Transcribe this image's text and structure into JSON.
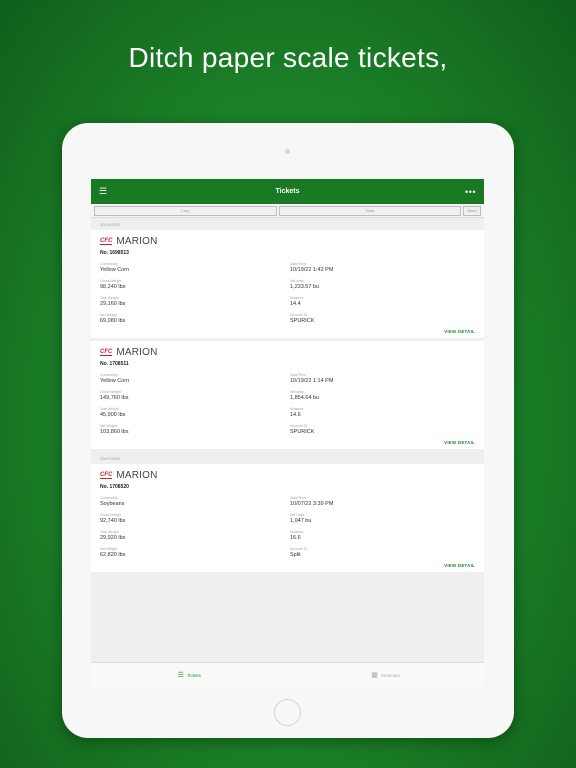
{
  "headline": "Ditch paper scale tickets,",
  "navbar": {
    "menu_icon": "hamburger-icon",
    "title": "Tickets",
    "more_icon": "more-icon"
  },
  "filters": {
    "crop": "Crop",
    "seas": "Seas",
    "more": "More"
  },
  "groups": [
    {
      "date": "10/19/2022",
      "tickets": [
        {
          "logo": "CFC",
          "location": "MARION",
          "number": "No. 1698513",
          "commodity_label": "Commodity",
          "commodity": "Yellow Corn",
          "datetime_label": "Date/Time",
          "datetime": "10/19/22 1:42 PM",
          "gross_label": "Gross Weight",
          "gross": "98,240 lbs",
          "net_units_label": "Net units",
          "net_units": "1,233.57 bu",
          "tare_label": "Tare Weight",
          "tare": "29,160 lbs",
          "moisture_label": "Moisture",
          "moisture": "14.4",
          "net_label": "Net Weight",
          "net": "69,080 lbs",
          "account_label": "Account ID",
          "account": "SPURICK",
          "detail": "VIEW DETAIL"
        },
        {
          "logo": "CFC",
          "location": "MARION",
          "number": "No. 1708511",
          "commodity_label": "Commodity",
          "commodity": "Yellow Corn",
          "datetime_label": "Date/Time",
          "datetime": "10/19/22 1:14 PM",
          "gross_label": "Gross Weight",
          "gross": "149,760 lbs",
          "net_units_label": "Net units",
          "net_units": "1,854.64 bu",
          "tare_label": "Tare Weight",
          "tare": "45,900 lbs",
          "moisture_label": "Moisture",
          "moisture": "14.6",
          "net_label": "Net Weight",
          "net": "103,860 lbs",
          "account_label": "Account ID",
          "account": "SPURICK",
          "detail": "VIEW DETAIL"
        }
      ]
    },
    {
      "date": "10/07/2022",
      "tickets": [
        {
          "logo": "CFC",
          "location": "MARION",
          "number": "No. 1708520",
          "commodity_label": "Commodity",
          "commodity": "Soybeans",
          "datetime_label": "Date/Time",
          "datetime": "10/07/22 3:39 PM",
          "gross_label": "Gross Weight",
          "gross": "92,740 lbs",
          "net_units_label": "Net Units",
          "net_units": "1,047 bu",
          "tare_label": "Tare Weight",
          "tare": "29,920 lbs",
          "moisture_label": "Moisture",
          "moisture": "16.6",
          "net_label": "Net Weight",
          "net": "62,820 lbs",
          "account_label": "Account ID",
          "account": "Split",
          "detail": "VIEW DETAIL"
        }
      ]
    }
  ],
  "tabbar": {
    "tickets": {
      "label": "Tickets",
      "icon": "list-icon"
    },
    "summary": {
      "label": "Summary",
      "icon": "calendar-icon"
    }
  },
  "colors": {
    "brand_green": "#1a7a24",
    "accent_green": "#1f8a2c",
    "logo_red": "#c8202f"
  }
}
